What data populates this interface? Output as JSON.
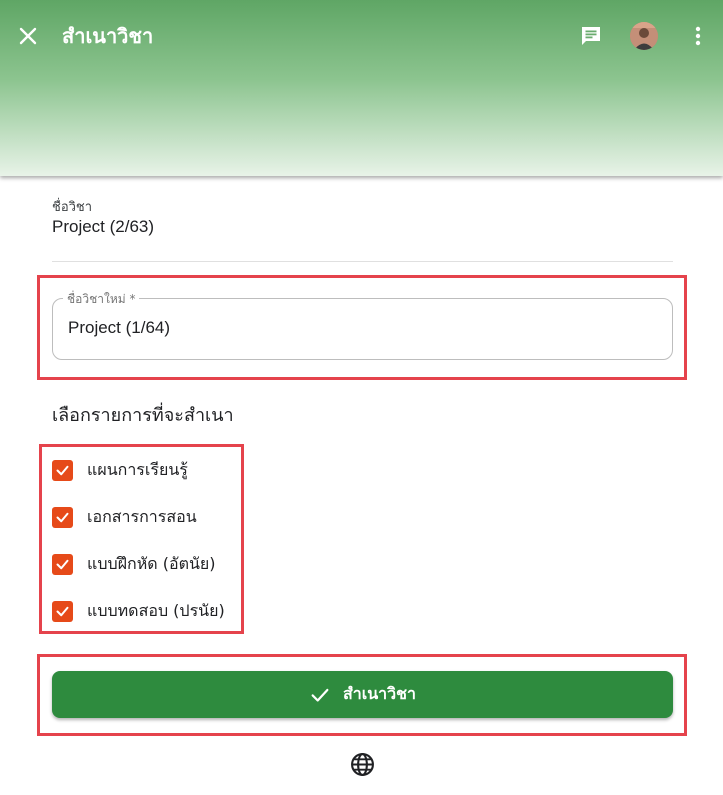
{
  "appbar": {
    "title": "สำเนาวิชา",
    "close_icon": "close-icon",
    "chat_icon": "chat-icon",
    "more_icon": "more-vert-icon",
    "gradient_top": "#5fa665",
    "gradient_bottom": "#e8f3e8"
  },
  "original": {
    "caption": "ชื่อวิชา",
    "value": "Project (2/63)"
  },
  "new_name": {
    "label": "ชื่อวิชาใหม่ *",
    "value": "Project (1/64)"
  },
  "copy_options": {
    "title": "เลือกรายการที่จะสำเนา",
    "items": [
      {
        "label": "แผนการเรียนรู้",
        "checked": true
      },
      {
        "label": "เอกสารการสอน",
        "checked": true
      },
      {
        "label": "แบบฝึกหัด (อัตนัย)",
        "checked": true
      },
      {
        "label": "แบบทดสอบ (ปรนัย)",
        "checked": true
      }
    ],
    "checkbox_color": "#e64a19"
  },
  "submit": {
    "label": "สำเนาวิชา",
    "icon": "check-icon",
    "color": "#2e8b3e"
  },
  "footer": {
    "icon": "globe-icon"
  },
  "highlight_color": "#e5434c"
}
